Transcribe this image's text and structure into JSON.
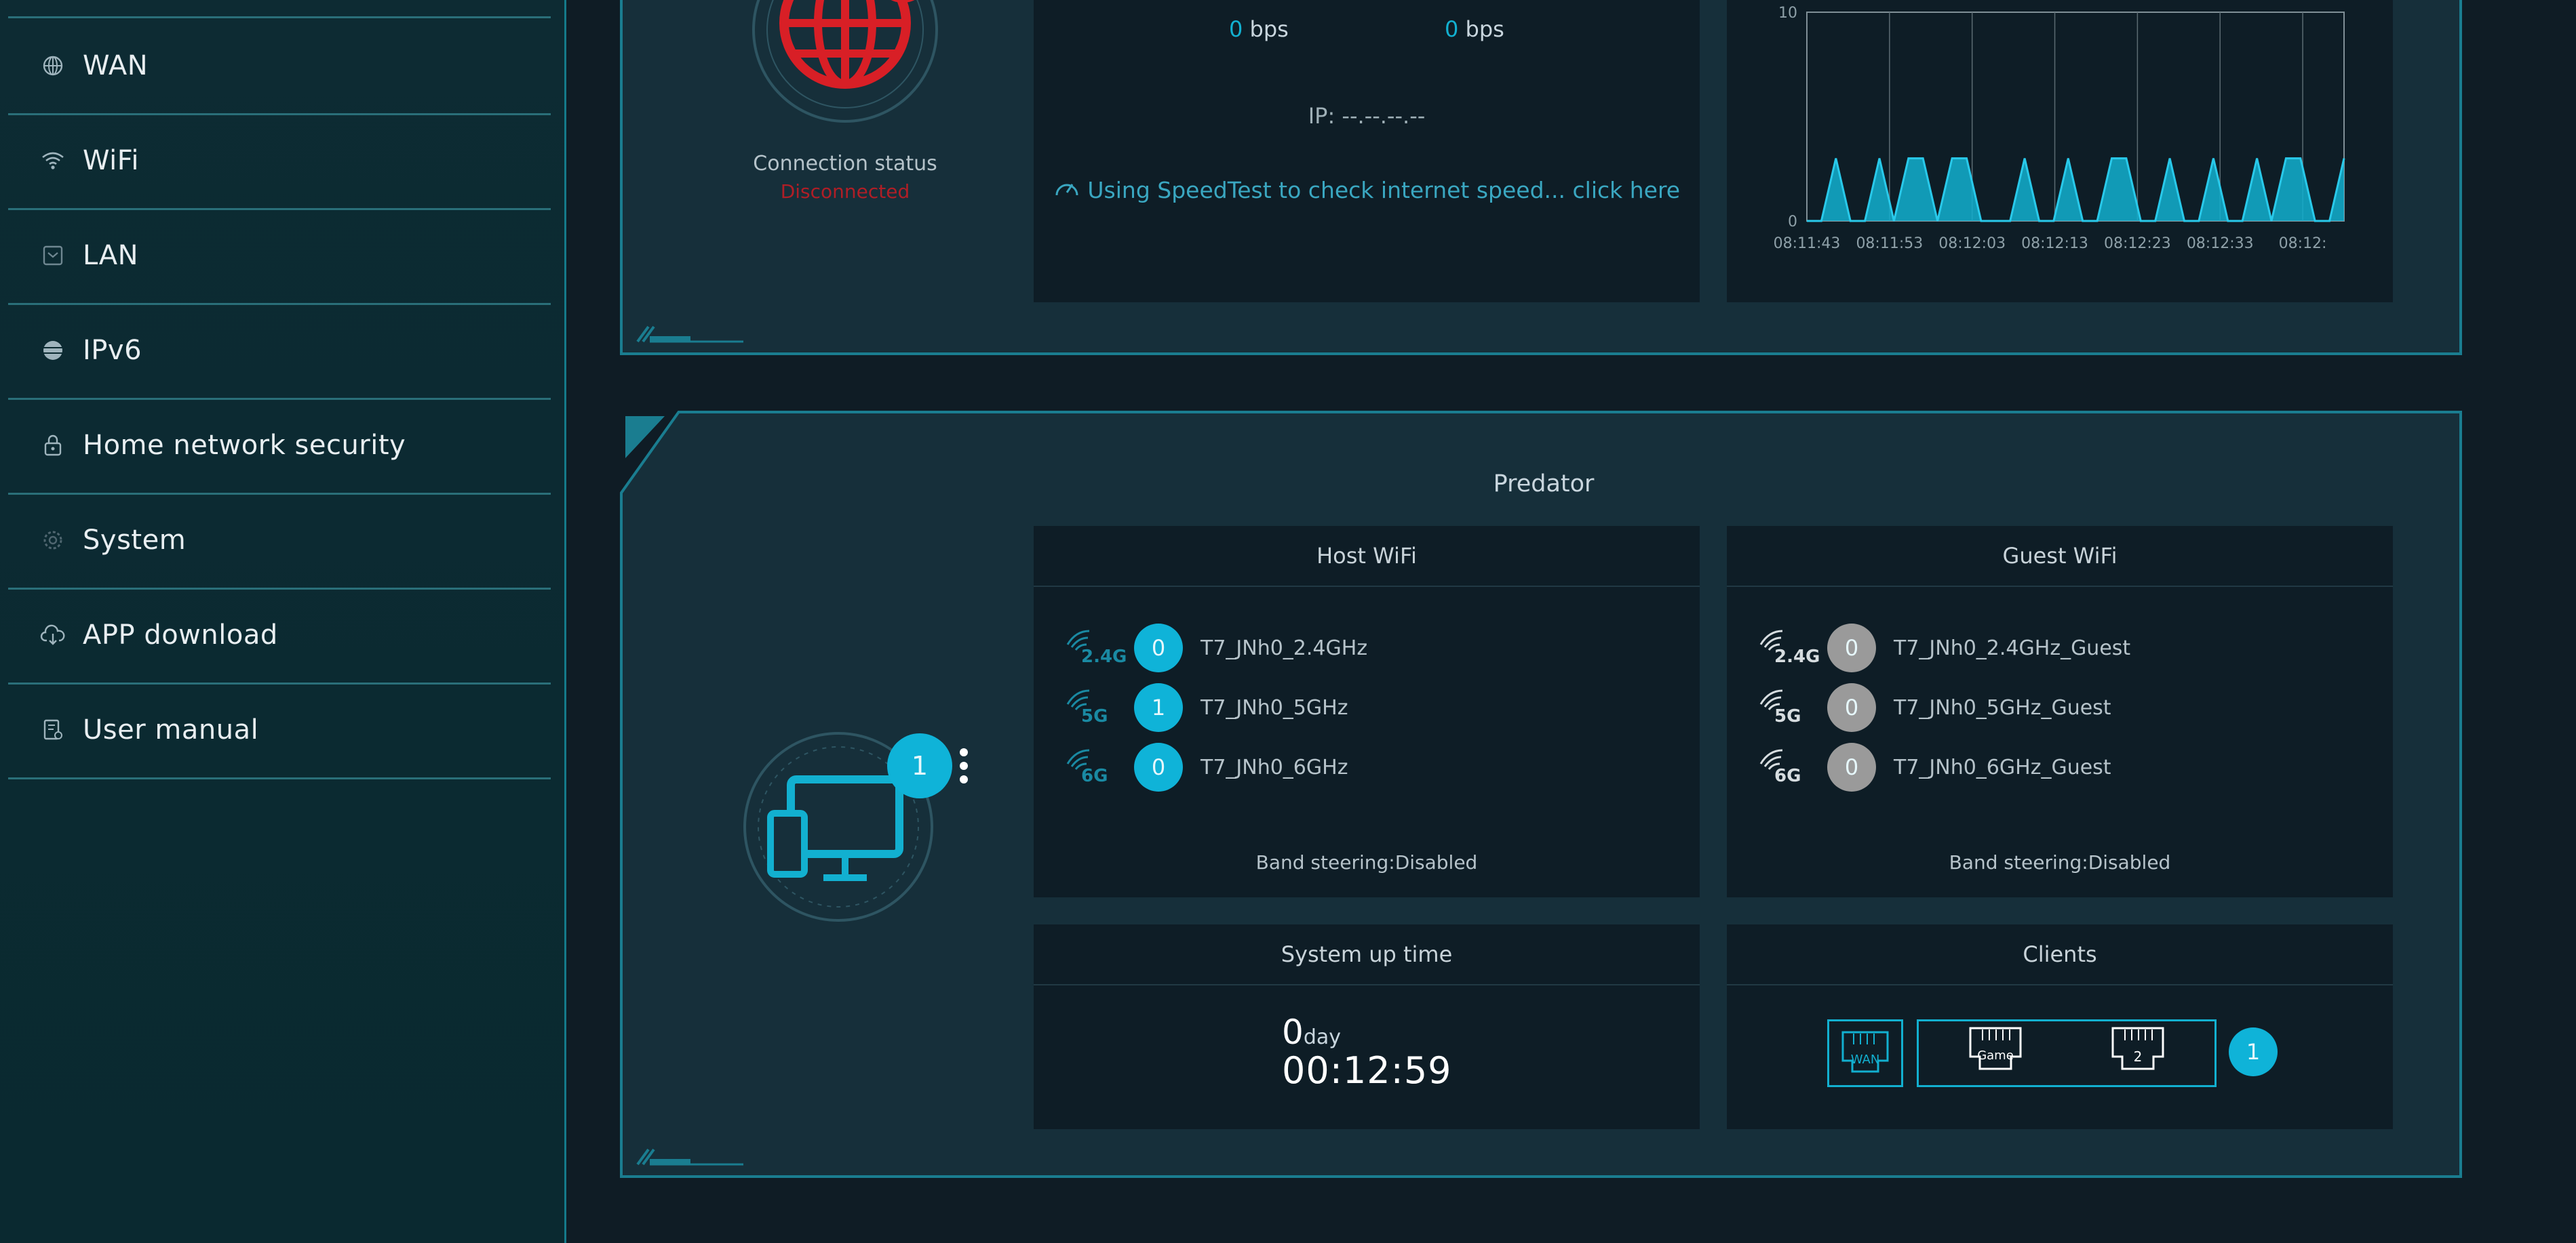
{
  "sidebar": {
    "items": [
      {
        "label": "WAN",
        "icon": "globe-icon"
      },
      {
        "label": "WiFi",
        "icon": "wifi-icon"
      },
      {
        "label": "LAN",
        "icon": "lan-icon"
      },
      {
        "label": "IPv6",
        "icon": "ipv6-globe-icon"
      },
      {
        "label": "Home network security",
        "icon": "lock-icon"
      },
      {
        "label": "System",
        "icon": "gear-icon"
      },
      {
        "label": "APP download",
        "icon": "cloud-download-icon"
      },
      {
        "label": "User manual",
        "icon": "manual-icon"
      }
    ]
  },
  "top_panel": {
    "connection_status_label": "Connection status",
    "connection_status_value": "Disconnected",
    "upload_value": "0",
    "upload_unit": "bps",
    "download_value": "0",
    "download_unit": "bps",
    "ip_text": "IP: --.--.--.--",
    "speedtest_link": "Using SpeedTest to check internet speed... click here"
  },
  "chart_data": {
    "type": "area",
    "ylim": [
      0,
      10
    ],
    "yticks": [
      "10",
      "0"
    ],
    "xticks": [
      "08:11:43",
      "08:11:53",
      "08:12:03",
      "08:12:13",
      "08:12:23",
      "08:12:33",
      "08:12:"
    ],
    "series": [
      {
        "values": [
          0,
          0,
          3,
          0,
          0,
          3,
          0,
          3,
          3,
          0,
          3,
          3,
          0,
          0,
          0,
          3,
          0,
          0,
          3,
          0,
          0,
          3,
          3,
          0,
          0,
          3,
          0,
          0,
          3,
          0,
          0,
          3,
          0,
          3,
          3,
          0,
          0,
          3
        ]
      }
    ],
    "color": "#12b0d0"
  },
  "bottom_panel": {
    "title": "Predator",
    "device_count": "1",
    "host_wifi": {
      "title": "Host WiFi",
      "bands": [
        {
          "band": "2.4G",
          "count": "0",
          "ssid": "T7_JNh0_2.4GHz"
        },
        {
          "band": "5G",
          "count": "1",
          "ssid": "T7_JNh0_5GHz"
        },
        {
          "band": "6G",
          "count": "0",
          "ssid": "T7_JNh0_6GHz"
        }
      ],
      "band_steering": "Band steering:Disabled"
    },
    "guest_wifi": {
      "title": "Guest WiFi",
      "bands": [
        {
          "band": "2.4G",
          "count": "0",
          "ssid": "T7_JNh0_2.4GHz_Guest"
        },
        {
          "band": "5G",
          "count": "0",
          "ssid": "T7_JNh0_5GHz_Guest"
        },
        {
          "band": "6G",
          "count": "0",
          "ssid": "T7_JNh0_6GHz_Guest"
        }
      ],
      "band_steering": "Band steering:Disabled"
    },
    "uptime": {
      "title": "System up time",
      "days": "0",
      "day_unit": "day",
      "time": "00:12:59"
    },
    "clients": {
      "title": "Clients",
      "port_wan": "WAN",
      "port_game": "Game",
      "port_2": "2",
      "count": "1"
    }
  },
  "colors": {
    "accent": "#0fb3d8",
    "danger": "#d81f26",
    "inactive": "#9a9a9a"
  }
}
